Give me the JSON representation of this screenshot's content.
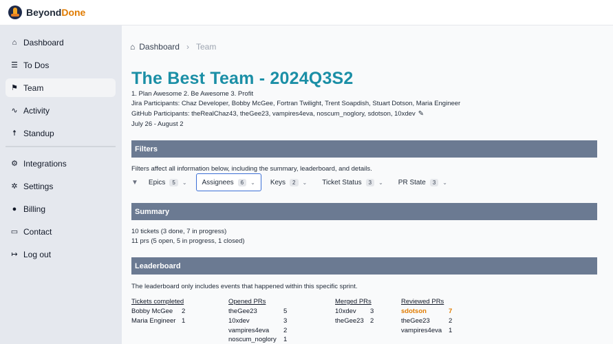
{
  "brand": {
    "name_part1": "Beyond",
    "name_part2": "Done",
    "logo_icon": "rocket-logo-icon"
  },
  "sidebar": {
    "items": [
      {
        "label": "Dashboard",
        "icon": "⌂",
        "active": false
      },
      {
        "label": "To Dos",
        "icon": "☰",
        "active": false
      },
      {
        "label": "Team",
        "icon": "⚑",
        "active": true
      },
      {
        "label": "Activity",
        "icon": "∿",
        "active": false
      },
      {
        "label": "Standup",
        "icon": "☨",
        "active": false
      },
      {
        "label": "Integrations",
        "icon": "⚙",
        "active": false
      },
      {
        "label": "Settings",
        "icon": "✲",
        "active": false
      },
      {
        "label": "Billing",
        "icon": "●",
        "active": false
      },
      {
        "label": "Contact",
        "icon": "▭",
        "active": false
      },
      {
        "label": "Log out",
        "icon": "↦",
        "active": false
      }
    ]
  },
  "breadcrumb": {
    "home_label": "Dashboard",
    "current": "Team",
    "separator": "›"
  },
  "team": {
    "title": "The Best Team - 2024Q3S2",
    "goals": "1. Plan Awesome 2. Be Awesome 3. Profit",
    "jira_participants": "Jira Participants: Chaz Developer, Bobby McGee, Fortran Twilight, Trent Soapdish, Stuart Dotson, Maria Engineer",
    "github_participants": "GitHub Participants: theRealChaz43, theGee23, vampires4eva, noscum_noglory, sdotson, 10xdev",
    "dates": "July 26 - August 2"
  },
  "filters": {
    "heading": "Filters",
    "description": "Filters affect all information below, including the summary, leaderboard, and details.",
    "chips": [
      {
        "label": "Epics",
        "count": "5",
        "active": false
      },
      {
        "label": "Assignees",
        "count": "6",
        "active": true
      },
      {
        "label": "Keys",
        "count": "2",
        "active": false
      },
      {
        "label": "Ticket Status",
        "count": "3",
        "active": false
      },
      {
        "label": "PR State",
        "count": "3",
        "active": false
      }
    ]
  },
  "summary": {
    "heading": "Summary",
    "tickets": "10 tickets (3 done, 7 in progress)",
    "prs": "11 prs (5 open, 5 in progress, 1 closed)"
  },
  "leaderboard": {
    "heading": "Leaderboard",
    "description": "The leaderboard only includes events that happened within this specific sprint.",
    "columns": [
      {
        "title": "Tickets completed",
        "rows": [
          {
            "name": "Bobby McGee",
            "value": "2"
          },
          {
            "name": "Maria Engineer",
            "value": "1"
          }
        ]
      },
      {
        "title": "Opened PRs",
        "rows": [
          {
            "name": "theGee23",
            "value": "5"
          },
          {
            "name": "10xdev",
            "value": "3"
          },
          {
            "name": "vampires4eva",
            "value": "2"
          },
          {
            "name": "noscum_noglory",
            "value": "1"
          }
        ]
      },
      {
        "title": "Merged PRs",
        "rows": [
          {
            "name": "10xdev",
            "value": "3"
          },
          {
            "name": "theGee23",
            "value": "2"
          }
        ]
      },
      {
        "title": "Reviewed PRs",
        "rows": [
          {
            "name": "sdotson",
            "value": "7",
            "highlight": true
          },
          {
            "name": "theGee23",
            "value": "2"
          },
          {
            "name": "vampires4eva",
            "value": "1"
          }
        ]
      }
    ]
  },
  "colors": {
    "accent_title": "#1b8fa6",
    "section_bar": "#6b7a92",
    "highlight": "#e07b00",
    "active_border": "#3b6fd6"
  }
}
